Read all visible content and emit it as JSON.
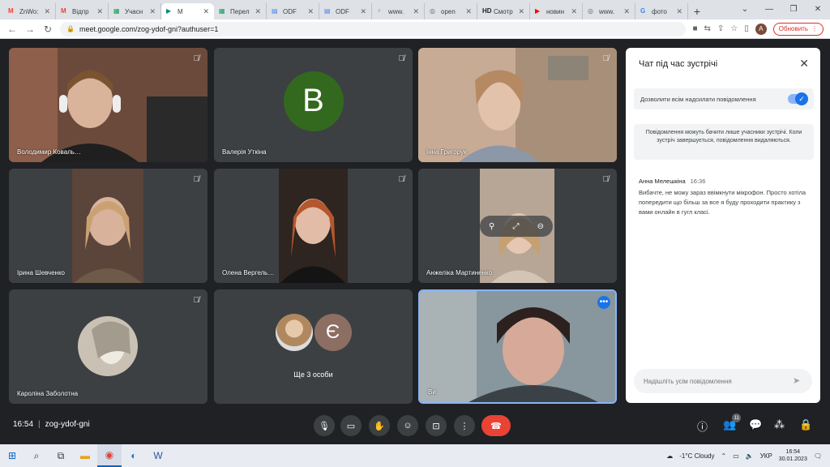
{
  "browser": {
    "tabs": [
      {
        "label": "ZnWo:",
        "fav_color": "#ea4335",
        "fav_glyph": "M"
      },
      {
        "label": "Відпр",
        "fav_color": "#ea4335",
        "fav_glyph": "M"
      },
      {
        "label": "Учасн",
        "fav_color": "#0f9d58",
        "fav_glyph": "▦"
      },
      {
        "label": "M",
        "fav_color": "#00897b",
        "fav_glyph": "▶",
        "active": true
      },
      {
        "label": "Перел",
        "fav_color": "#0f9d58",
        "fav_glyph": "▦"
      },
      {
        "label": "ODF",
        "fav_color": "#4285f4",
        "fav_glyph": "▤"
      },
      {
        "label": "ODF",
        "fav_color": "#4285f4",
        "fav_glyph": "▤"
      },
      {
        "label": "www.",
        "fav_color": "#9aa0a6",
        "fav_glyph": "⚡"
      },
      {
        "label": "open",
        "fav_color": "#5f6368",
        "fav_glyph": "◎"
      },
      {
        "label": "Смотр",
        "fav_color": "#202124",
        "fav_glyph": "HD"
      },
      {
        "label": "новин",
        "fav_color": "#ff0000",
        "fav_glyph": "▶"
      },
      {
        "label": "www.",
        "fav_color": "#5f6368",
        "fav_glyph": "◎"
      },
      {
        "label": "фото",
        "fav_color": "#4285f4",
        "fav_glyph": "G"
      }
    ],
    "url": "meet.google.com/zog-ydof-gni?authuser=1",
    "profile_initial": "A",
    "update_label": "Обновить"
  },
  "participants": [
    {
      "name": "Володимир Коваль…",
      "kind": "video",
      "bg": "#7a4f3a"
    },
    {
      "name": "Валерія Уткіна",
      "kind": "letter",
      "letter": "В"
    },
    {
      "name": "Інна Григорук",
      "kind": "video",
      "bg": "#b89a86"
    },
    {
      "name": "Ірина Шевченко",
      "kind": "video",
      "bg": "#4e3b33"
    },
    {
      "name": "Олена Вергель…",
      "kind": "video",
      "bg": "#3a2a24"
    },
    {
      "name": "Анжеліка Мартиненко",
      "kind": "video",
      "bg": "#9c8b7e"
    },
    {
      "name": "Кароліна Заболотна",
      "kind": "bust"
    },
    {
      "name": "",
      "kind": "more",
      "more_letter": "Є",
      "more_label": "Ще 3 особи"
    },
    {
      "name": "Ви",
      "kind": "self",
      "bg": "#6c7a80"
    }
  ],
  "chat": {
    "title": "Чат під час зустрічі",
    "allow_label": "Дозволити всім надсилати повідомлення",
    "notice": "Повідомлення можуть бачити лише учасники зустрічі. Коли зустріч завершується, повідомлення видаляються.",
    "message": {
      "author": "Анна Мелешкіна",
      "time": "16:36",
      "text": "Вибачте, не можу зараз ввімкнути мікрофон. Просто хотіла попередити що більш за все я буду проходити практику з вами онлайн в гугл класі."
    },
    "input_placeholder": "Надішліть усім повідомлення"
  },
  "meeting": {
    "time": "16:54",
    "code": "zog-ydof-gni",
    "participants_count": "11"
  },
  "taskbar": {
    "weather": "-1°C  Cloudy",
    "lang": "УКР",
    "clock_time": "16:54",
    "clock_date": "30.01.2023"
  }
}
